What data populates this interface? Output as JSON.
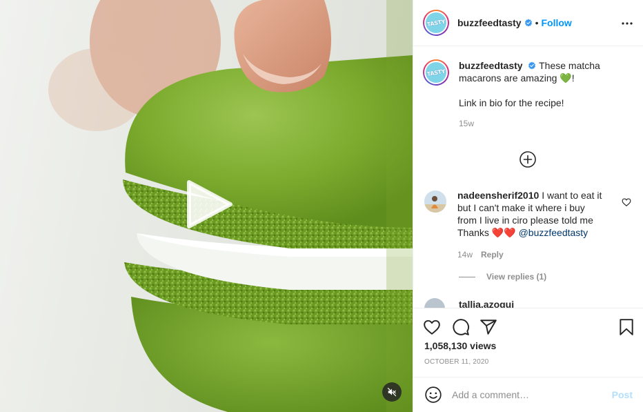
{
  "media": {
    "play_icon": "play-icon",
    "mute_icon": "muted-speaker-icon"
  },
  "header": {
    "avatar_text": "TASTY",
    "username": "buzzfeedtasty",
    "verified_icon": "verified-badge-icon",
    "separator": "•",
    "follow_label": "Follow",
    "more_icon": "more-options-icon"
  },
  "caption": {
    "username": "buzzfeedtasty",
    "text_part1": "These matcha macarons are amazing",
    "emoji": "💚",
    "text_part2": "!",
    "line2": "Link in bio for the recipe!",
    "time": "15w"
  },
  "load_more_icon": "plus-circle-icon",
  "comments": [
    {
      "username": "nadeensherif2010",
      "text": "I want to eat it but I can't make it where i buy from I live in ciro please told me Thanks",
      "emoji": "❤️❤️",
      "mention": "@buzzfeedtasty",
      "time": "14w",
      "reply_label": "Reply",
      "view_replies": "View replies (1)"
    },
    {
      "username": "tallia.azoqui"
    }
  ],
  "actions": {
    "like_icon": "heart-icon",
    "comment_icon": "comment-icon",
    "share_icon": "send-icon",
    "save_icon": "bookmark-icon",
    "views": "1,058,130 views",
    "date": "OCTOBER 11, 2020"
  },
  "add_comment": {
    "emoji_icon": "smiley-icon",
    "placeholder": "Add a comment…",
    "post_label": "Post"
  },
  "colors": {
    "link_blue": "#0095f6",
    "mention_blue": "#00376b",
    "muted_grey": "#8e8e8e",
    "macaron_green": "#78a82a"
  }
}
